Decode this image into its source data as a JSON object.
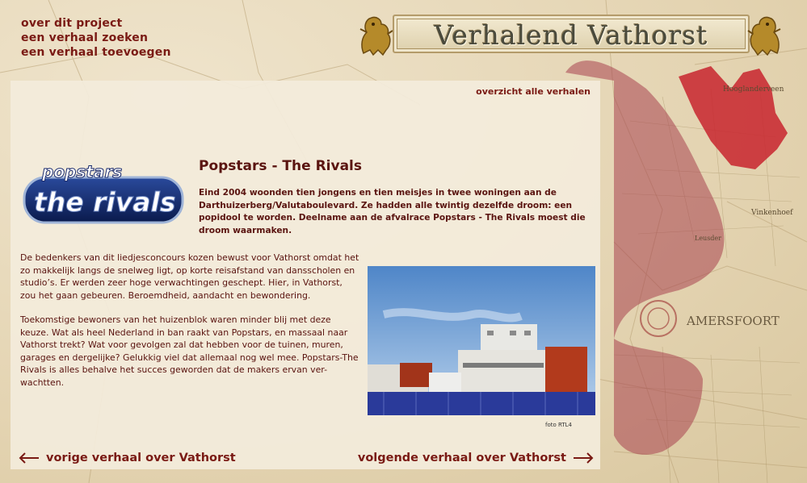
{
  "nav": {
    "items": [
      {
        "label": "over dit project"
      },
      {
        "label": "een verhaal zoeken"
      },
      {
        "label": "een verhaal toevoegen"
      }
    ]
  },
  "banner": {
    "title": "Verhalend Vathorst"
  },
  "panel": {
    "overview_link": "overzicht alle verhalen",
    "logo": {
      "line1": "popstars",
      "line2": "the rivals",
      "icon": "popstars-logo"
    },
    "title": "Popstars - The Rivals",
    "intro": "Eind 2004 woonden tien jongens en tien meisjes in twee woningen aan de Darthuizerberg/Valutaboulevard. Ze hadden alle twintig dezelfde droom: een popidool te worden. Deelname aan de afvalrace Popstars - The Rivals moest die droom waarmaken.",
    "paragraphs": [
      "De bedenkers van dit liedjesconcours kozen bewust voor Vathorst omdat het zo makkelijk langs de snelweg ligt, op korte reisafstand van dansscholen en studio’s. Er werden zeer hoge verwachtingen geschept. Hier, in Vathorst, zou het gaan gebeuren. Beroemdheid, aandacht en bewondering.",
      "Toekomstige bewoners van het huizenblok waren minder blij met deze keuze. Wat als heel Nederland in ban raakt van Popstars, en massaal naar Vathorst trekt? Wat voor gevolgen zal dat hebben voor de tuinen, muren, garages en dergelijke? Gelukkig viel dat allemaal nog wel mee. Popstars-The Rivals is alles behalve het succes geworden dat de makers ervan ver-wachtten."
    ],
    "photo_credit": "foto RTL4",
    "prev_link": "vorige verhaal over Vathorst",
    "next_link": "volgende verhaal over Vathorst"
  },
  "map": {
    "labels": [
      "Hooglanderveen",
      "Vinkenhoef",
      "Leusder",
      "AMERSFOORT"
    ]
  },
  "colors": {
    "link": "#7a1a14",
    "text": "#5a1410",
    "region_dark": "#c8242e",
    "region_light": "#a8424e"
  }
}
